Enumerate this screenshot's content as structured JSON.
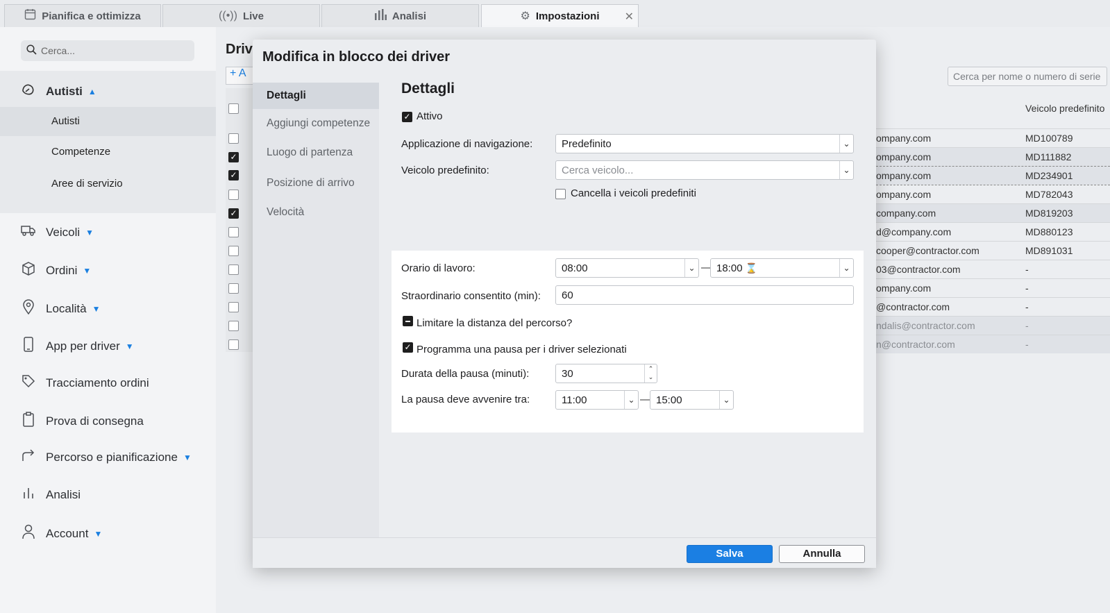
{
  "tabs": [
    {
      "label": "Pianifica e ottimizza",
      "icon": "calendar-icon"
    },
    {
      "label": "Live",
      "icon": "broadcast-icon"
    },
    {
      "label": "Analisi",
      "icon": "bar-chart-icon"
    },
    {
      "label": "Impostazioni",
      "icon": "gear-icon"
    }
  ],
  "sidebar": {
    "search_placeholder": "Cerca...",
    "autisti": "Autisti",
    "sub": [
      "Autisti",
      "Competenze",
      "Aree di servizio"
    ],
    "items": [
      "Veicoli",
      "Ordini",
      "Località",
      "App per driver",
      "Tracciamento ordini",
      "Prova di consegna",
      "Percorso e pianificazione",
      "Analisi",
      "Account"
    ]
  },
  "background": {
    "title": "Driv",
    "add_label": "A",
    "search_placeholder": "Cerca per nome o numero di serie",
    "column_vehicle": "Veicolo predefinito",
    "rows": [
      {
        "email": "ompany.com",
        "vehicle": "MD100789"
      },
      {
        "email": "ompany.com",
        "vehicle": "MD111882"
      },
      {
        "email": "ompany.com",
        "vehicle": "MD234901"
      },
      {
        "email": "ompany.com",
        "vehicle": "MD782043"
      },
      {
        "email": "company.com",
        "vehicle": "MD819203"
      },
      {
        "email": "d@company.com",
        "vehicle": "MD880123"
      },
      {
        "email": "cooper@contractor.com",
        "vehicle": "MD891031"
      },
      {
        "email": "03@contractor.com",
        "vehicle": "-"
      },
      {
        "email": "ompany.com",
        "vehicle": "-"
      },
      {
        "email": "@contractor.com",
        "vehicle": "-"
      },
      {
        "email": "ndalis@contractor.com",
        "vehicle": "-"
      },
      {
        "email": "n@contractor.com",
        "vehicle": "-"
      }
    ]
  },
  "modal": {
    "title": "Modifica in blocco dei driver",
    "nav": [
      "Dettagli",
      "Aggiungi competenze",
      "Luogo di partenza",
      "Posizione di arrivo",
      "Velocità"
    ],
    "section_title": "Dettagli",
    "attivo": "Attivo",
    "nav_app_label": "Applicazione di navigazione:",
    "nav_app_value": "Predefinito",
    "vehicle_label": "Veicolo predefinito:",
    "vehicle_placeholder": "Cerca veicolo...",
    "clear_vehicles": "Cancella i veicoli predefiniti",
    "work_hours_label": "Orario di lavoro:",
    "work_start": "08:00",
    "work_end": "18:00",
    "overtime_label": "Straordinario consentito (min):",
    "overtime_value": "60",
    "limit_distance": "Limitare la distanza del percorso?",
    "schedule_break": "Programma una pausa per i driver selezionati",
    "break_duration_label": "Durata della pausa (minuti):",
    "break_duration_value": "30",
    "break_window_label": "La pausa deve avvenire tra:",
    "break_start": "11:00",
    "break_end": "15:00",
    "save": "Salva",
    "cancel": "Annulla"
  }
}
